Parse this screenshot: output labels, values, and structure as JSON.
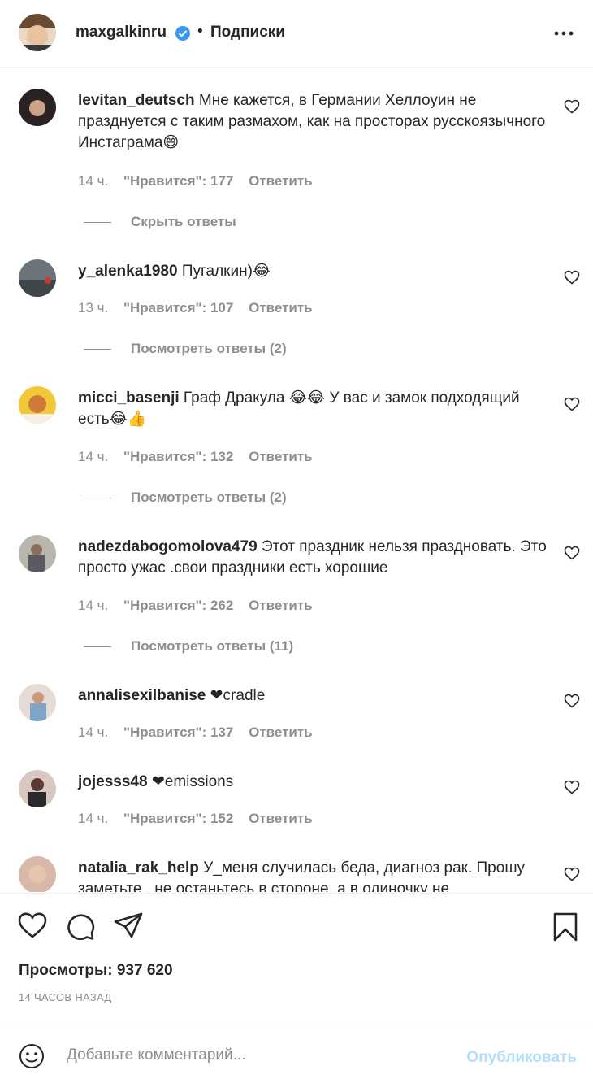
{
  "header": {
    "username": "maxgalkinru",
    "dot": "•",
    "follow_status": "Подписки"
  },
  "comments": [
    {
      "username": "levitan_deutsch",
      "text": "Мне кажется, в Германии Хеллоуин не празднуется с таким размахом, как на просторах русскоязычного Инстаграма😄",
      "time": "14 ч.",
      "likes": "\"Нравится\": 177",
      "reply": "Ответить",
      "replies_toggle": "Скрыть ответы"
    },
    {
      "username": "y_alenka1980",
      "text": "Пугалкин)😂",
      "time": "13 ч.",
      "likes": "\"Нравится\": 107",
      "reply": "Ответить",
      "replies_toggle": "Посмотреть ответы (2)"
    },
    {
      "username": "micci_basenji",
      "text": "Граф Дракула 😂😂 У вас и замок подходящий есть😂👍",
      "time": "14 ч.",
      "likes": "\"Нравится\": 132",
      "reply": "Ответить",
      "replies_toggle": "Посмотреть ответы (2)"
    },
    {
      "username": "nadezdabogomolova479",
      "text": "Этот праздник нельзя праздновать. Это просто ужас .свои праздники есть хорошие",
      "time": "14 ч.",
      "likes": "\"Нравится\": 262",
      "reply": "Ответить",
      "replies_toggle": "Посмотреть ответы (11)"
    },
    {
      "username": "annalisexilbanise",
      "text": "❤cradle",
      "time": "14 ч.",
      "likes": "\"Нравится\": 137",
      "reply": "Ответить"
    },
    {
      "username": "jojesss48",
      "text": "❤emissions",
      "time": "14 ч.",
      "likes": "\"Нравится\": 152",
      "reply": "Ответить"
    },
    {
      "username": "natalia_rak_help",
      "text": "У_меня случилась беда, диагноз рак. Прошу заметьте , не останьтесь в стороне, а в одиночку не"
    }
  ],
  "footer": {
    "views": "Просмотры: 937 620",
    "time_ago": "14 ЧАСОВ НАЗАД",
    "comment_placeholder": "Добавьте комментарий...",
    "publish_label": "Опубликовать"
  },
  "colors": {
    "text": "#262626",
    "secondary": "#8e8e8e",
    "verified": "#3897f0",
    "publish_disabled": "#b2dffc",
    "divider": "#efefef"
  }
}
